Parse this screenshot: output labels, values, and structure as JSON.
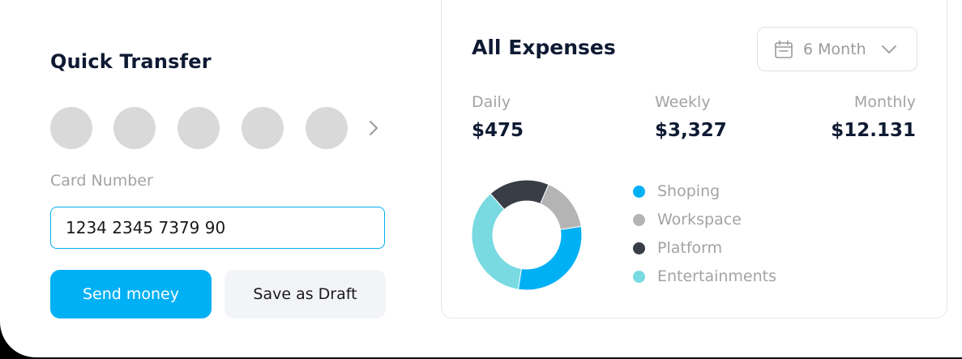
{
  "quick_transfer": {
    "title": "Quick Transfer",
    "card_number_label": "Card Number",
    "card_number_value": "1234 2345 7379 90",
    "send_button": "Send money",
    "draft_button": "Save as Draft",
    "avatar_color": "#d9d9d9",
    "next_icon": "chevron-right-icon"
  },
  "expenses": {
    "title": "All Expenses",
    "period": {
      "label": "6 Month",
      "icon": "calendar-icon",
      "dropdown_icon": "chevron-down-icon"
    },
    "stats": [
      {
        "label": "Daily",
        "value": "$475"
      },
      {
        "label": "Weekly",
        "value": "$3,327"
      },
      {
        "label": "Monthly",
        "value": "$12.131"
      }
    ]
  },
  "chart_data": {
    "type": "pie",
    "variant": "donut",
    "series": [
      {
        "name": "Shoping",
        "value": 30,
        "color": "#00b0f5"
      },
      {
        "name": "Workspace",
        "value": 16,
        "color": "#b4b4b4"
      },
      {
        "name": "Platform",
        "value": 18,
        "color": "#393d46"
      },
      {
        "name": "Entertainments",
        "value": 36,
        "color": "#79dae1"
      }
    ],
    "segment_order": [
      "Platform",
      "Workspace",
      "Shoping",
      "Entertainments"
    ],
    "legend_position": "right"
  }
}
